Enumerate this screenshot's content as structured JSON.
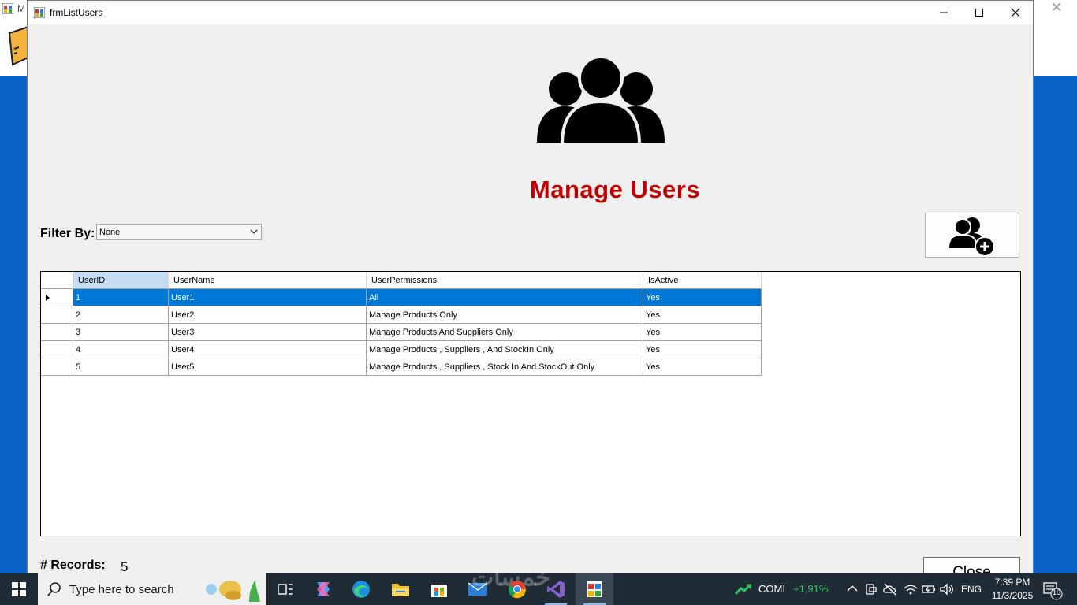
{
  "background_window": {
    "title_fragment": "M"
  },
  "form": {
    "title": "frmListUsers",
    "heading": "Manage Users",
    "filter_label": "Filter By:",
    "filter_value": "None",
    "records_label": "# Records:",
    "records_value": "5",
    "close_label": "Close"
  },
  "grid": {
    "columns": [
      "UserID",
      "UserName",
      "UserPermissions",
      "IsActive"
    ],
    "rows": [
      {
        "id": "1",
        "name": "User1",
        "permissions": "All",
        "active": "Yes"
      },
      {
        "id": "2",
        "name": "User2",
        "permissions": "Manage Products Only",
        "active": "Yes"
      },
      {
        "id": "3",
        "name": "User3",
        "permissions": "Manage Products And Suppliers Only",
        "active": "Yes"
      },
      {
        "id": "4",
        "name": "User4",
        "permissions": "Manage Products , Suppliers , And StockIn Only",
        "active": "Yes"
      },
      {
        "id": "5",
        "name": "User5",
        "permissions": "Manage Products , Suppliers , Stock In And StockOut Only",
        "active": "Yes"
      }
    ],
    "selected_row": 0
  },
  "taskbar": {
    "search_placeholder": "Type here to search",
    "stock_name": "COMI",
    "stock_change": "+1,91%",
    "language": "ENG",
    "time": "7:39 PM",
    "date": "11/3/2025",
    "notification_count": "10"
  },
  "colors": {
    "heading": "#c00000",
    "selection": "#0078d7",
    "header_selected": "#c5dcf2",
    "desktop": "#0a63c9",
    "stock_up": "#36c25e"
  }
}
